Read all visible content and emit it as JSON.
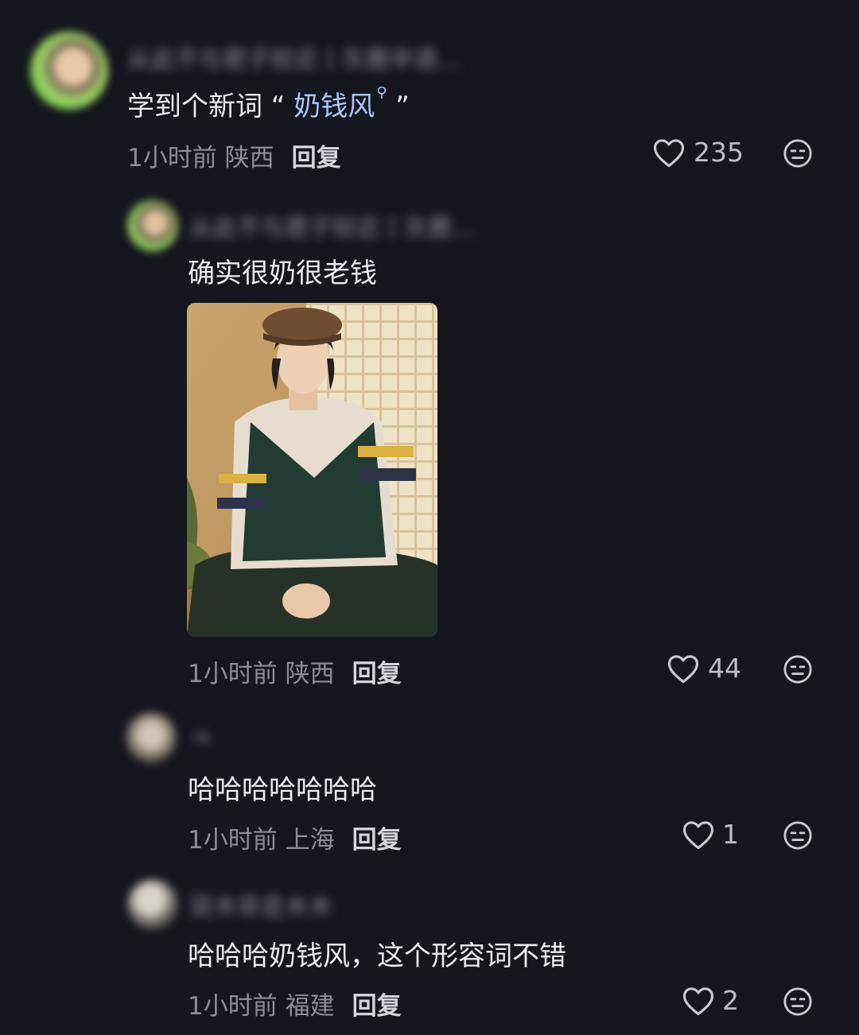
{
  "colors": {
    "background": "#16161e",
    "link": "#a9c6ff",
    "meta": "#8d8d96"
  },
  "comments": [
    {
      "avatar": "user-avatar-blurred",
      "username": "从此不与君子较近丨灰鹿辛语…",
      "text_prefix": "学到个新词 “ ",
      "text_link": "奶钱风",
      "text_suffix": " ”",
      "time": "1小时前",
      "location": "陕西",
      "reply_label": "回复",
      "likes": "235"
    },
    {
      "avatar": "user-avatar-blurred",
      "username": "从此不与君子较近丨灰鹿…",
      "text": "确实很奶很老钱",
      "image": "photo-man-in-beret-and-sweater-vest",
      "time": "1小时前",
      "location": "陕西",
      "reply_label": "回复",
      "likes": "44"
    },
    {
      "avatar": "user-avatar-blurred",
      "username": "ㅋ",
      "text": "哈哈哈哈哈哈哈",
      "time": "1小时前",
      "location": "上海",
      "reply_label": "回复",
      "likes": "1"
    },
    {
      "avatar": "user-avatar-blurred",
      "username": "双木非走木木",
      "text": "哈哈哈奶钱风，这个形容词不错",
      "time": "1小时前",
      "location": "福建",
      "reply_label": "回复",
      "likes": "2"
    }
  ]
}
